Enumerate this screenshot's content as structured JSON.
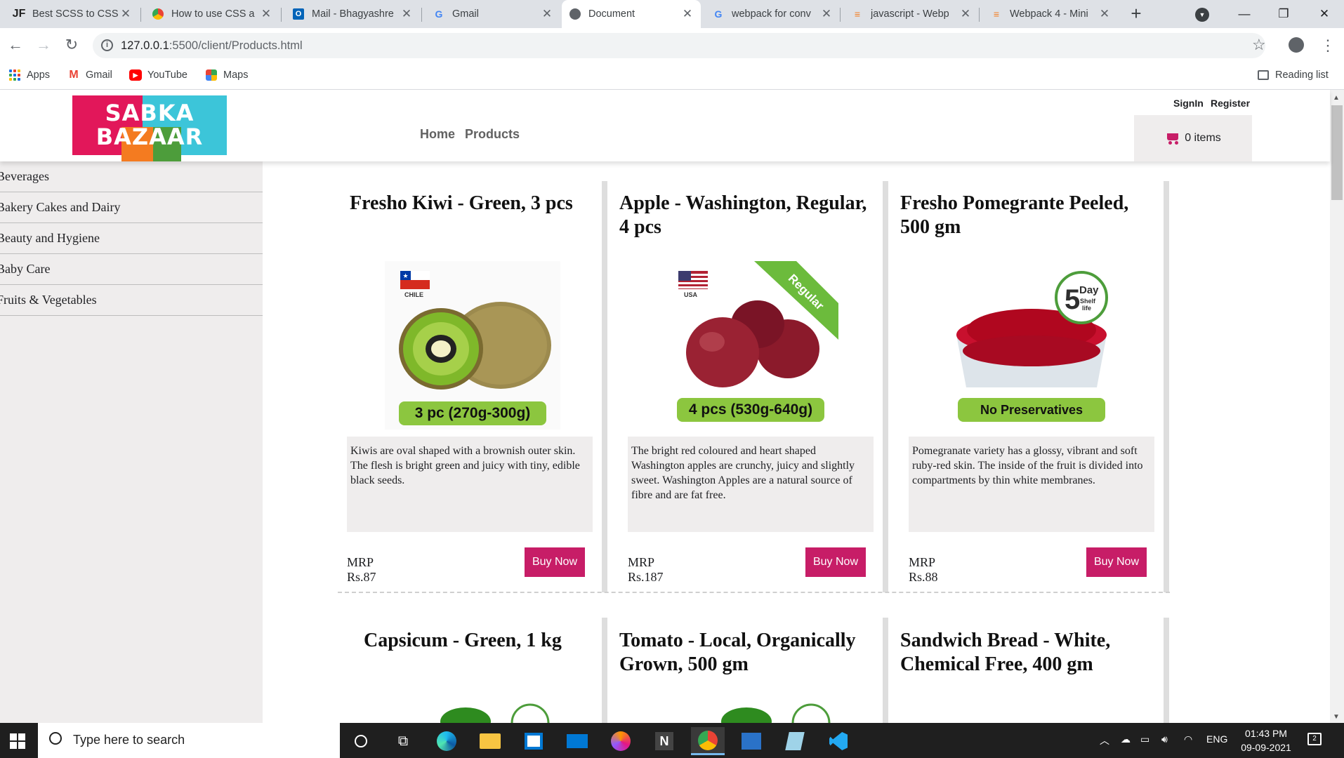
{
  "browser": {
    "tabs": [
      {
        "title": "Best SCSS to CSS",
        "favicon": "JF",
        "active": false
      },
      {
        "title": "How to use CSS a",
        "favicon": "chrome-icon",
        "active": false
      },
      {
        "title": "Mail - Bhagyashre",
        "favicon": "outlook-icon",
        "active": false
      },
      {
        "title": "Gmail",
        "favicon": "google-icon",
        "active": false
      },
      {
        "title": "Document",
        "favicon": "globe-icon",
        "active": true
      },
      {
        "title": "webpack for conv",
        "favicon": "google-icon",
        "active": false
      },
      {
        "title": "javascript - Webp",
        "favicon": "stackoverflow-icon",
        "active": false
      },
      {
        "title": "Webpack 4 - Mini",
        "favicon": "stackoverflow-icon",
        "active": false
      }
    ],
    "url_host": "127.0.0.1",
    "url_rest": ":5500/client/Products.html",
    "bookmarks": [
      {
        "label": "Apps"
      },
      {
        "label": "Gmail"
      },
      {
        "label": "YouTube"
      },
      {
        "label": "Maps"
      }
    ],
    "reading_list": "Reading list"
  },
  "site": {
    "logo_line1": "SABKA",
    "logo_line2": "BAZAAR",
    "nav": [
      "Home",
      "Products"
    ],
    "signin": "SignIn",
    "register": "Register",
    "cart_label": "0 items",
    "brand_color": "#c71d67"
  },
  "sidebar": {
    "categories": [
      "Beverages",
      "Bakery Cakes and Dairy",
      "Beauty and Hygiene",
      "Baby Care",
      "Fruits & Vegetables"
    ]
  },
  "products": [
    {
      "title": "Fresho Kiwi - Green, 3 pcs",
      "image_badge": "3 pc (270g-300g)",
      "origin": "CHILE",
      "description": "Kiwis are oval shaped with a brownish outer skin. The flesh is bright green and juicy with tiny, edible black seeds.",
      "price": "MRP Rs.87",
      "buy_label": "Buy Now"
    },
    {
      "title": "Apple - Washington, Regular, 4 pcs",
      "image_badge": "4 pcs (530g-640g)",
      "origin": "USA",
      "ribbon": "Regular",
      "description": "The bright red coloured and heart shaped Washington apples are crunchy, juicy and slightly sweet. Washington Apples are a natural source of fibre and are fat free.",
      "price": "MRP Rs.187",
      "buy_label": "Buy Now"
    },
    {
      "title": "Fresho Pomegrante Peeled, 500 gm",
      "image_badge": "No Preservatives",
      "shelf_badge_num": "5",
      "shelf_badge_word": "Day",
      "shelf_badge_sub1": "Shelf",
      "shelf_badge_sub2": "life",
      "description": "Pomegranate variety has a glossy, vibrant and soft ruby-red skin. The inside of the fruit is divided into compartments by thin white membranes.",
      "price": "MRP Rs.88",
      "buy_label": "Buy Now"
    },
    {
      "title": "Capsicum - Green, 1 kg"
    },
    {
      "title": "Tomato - Local, Organically Grown, 500 gm"
    },
    {
      "title": "Sandwich Bread - White, Chemical Free, 400 gm"
    }
  ],
  "taskbar": {
    "search_placeholder": "Type here to search",
    "language": "ENG",
    "time": "01:43 PM",
    "date": "09-09-2021",
    "notifications": "2"
  }
}
